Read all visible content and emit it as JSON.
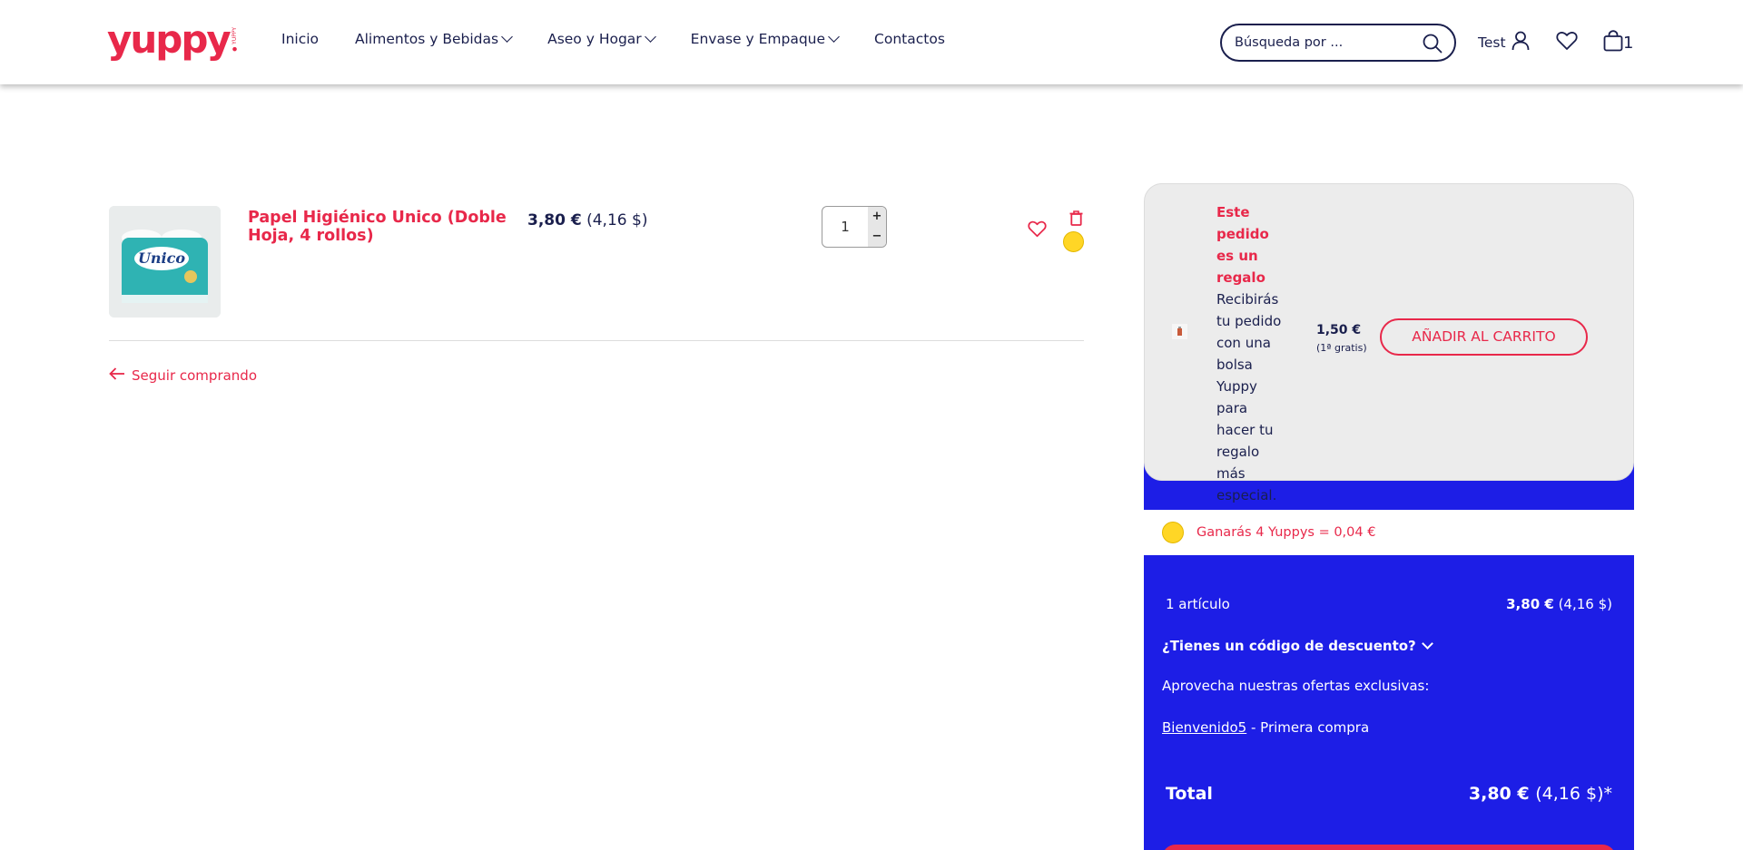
{
  "header": {
    "logo_text": "yuppy",
    "logo_side": "● YUPPY",
    "nav": [
      {
        "label": "Inicio"
      },
      {
        "label": "Alimentos y Bebidas"
      },
      {
        "label": "Aseo y Hogar"
      },
      {
        "label": "Envase y Empaque"
      },
      {
        "label": "Contactos"
      }
    ],
    "search_placeholder": "Búsqueda por ...",
    "user_label": "Test",
    "cart_count": "1"
  },
  "cart": {
    "item": {
      "name": "Papel Higiénico Unico (Doble Hoja, 4 rollos)",
      "price_eur": "3,80 €",
      "price_usd": "(4,16 $)",
      "quantity": "1",
      "image_brand": "Unico"
    },
    "continue_label": "Seguir comprando"
  },
  "summary": {
    "gift": {
      "title": "Este pedido es un regalo",
      "text": "Recibirás tu pedido con una bolsa Yuppy para hacer tu regalo más especial.",
      "price": "1,50 €",
      "note": "(1ª gratis)",
      "button": "AÑADIR AL CARRITO"
    },
    "yuppys": "Ganarás 4 Yuppys = 0,04 €",
    "articles_label": "1 artículo",
    "articles_eur": "3,80 €",
    "articles_usd": "(4,16 $)",
    "discount_label": "¿Tienes un código de descuento?",
    "offers_label": "Aprovecha nuestras ofertas exclusivas:",
    "promo_code": "Bienvenido5",
    "promo_desc": " - Primera compra",
    "total_label": "Total",
    "total_eur": "3,80 €",
    "total_usd": "(4,16 $)*"
  },
  "colors": {
    "brand_red": "#e8284a",
    "brand_blue": "#1d1ee6",
    "text_dark": "#1a1f4d"
  }
}
